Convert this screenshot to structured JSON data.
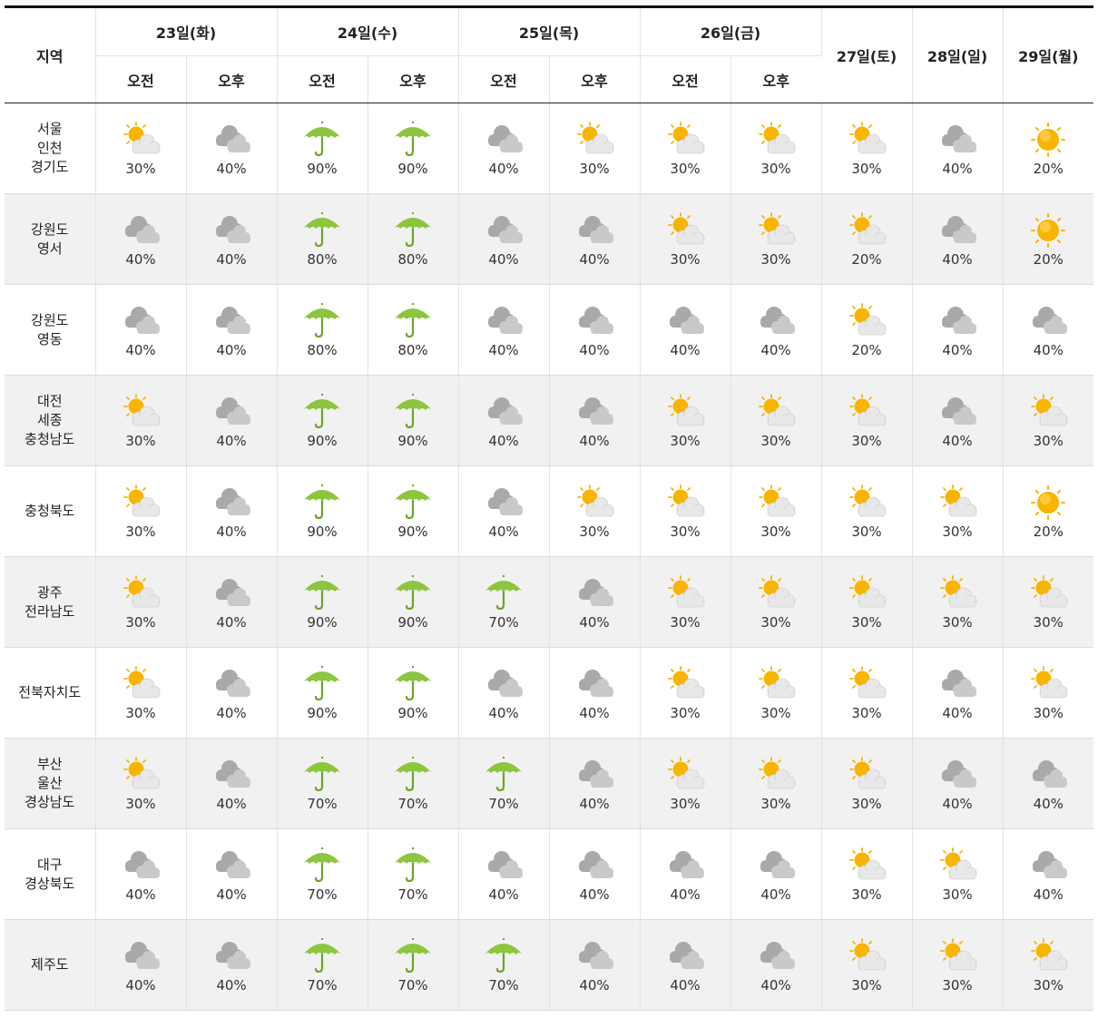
{
  "header": {
    "region_label": "지역",
    "days_split": [
      {
        "label": "23일(화)",
        "am": "오전",
        "pm": "오후"
      },
      {
        "label": "24일(수)",
        "am": "오전",
        "pm": "오후"
      },
      {
        "label": "25일(목)",
        "am": "오전",
        "pm": "오후"
      },
      {
        "label": "26일(금)",
        "am": "오전",
        "pm": "오후"
      }
    ],
    "days_single": [
      "27일(토)",
      "28일(일)",
      "29일(월)"
    ]
  },
  "rows": [
    {
      "region": [
        "서울",
        "인천",
        "경기도"
      ],
      "cells": [
        {
          "icon": "partly-cloudy",
          "pct": "30%"
        },
        {
          "icon": "cloudy",
          "pct": "40%"
        },
        {
          "icon": "rain-umbrella",
          "pct": "90%"
        },
        {
          "icon": "rain-umbrella",
          "pct": "90%"
        },
        {
          "icon": "cloudy",
          "pct": "40%"
        },
        {
          "icon": "partly-cloudy",
          "pct": "30%"
        },
        {
          "icon": "partly-cloudy",
          "pct": "30%"
        },
        {
          "icon": "partly-cloudy",
          "pct": "30%"
        },
        {
          "icon": "partly-cloudy",
          "pct": "30%"
        },
        {
          "icon": "cloudy",
          "pct": "40%"
        },
        {
          "icon": "sunny",
          "pct": "20%"
        }
      ]
    },
    {
      "region": [
        "강원도",
        "영서"
      ],
      "cells": [
        {
          "icon": "cloudy",
          "pct": "40%"
        },
        {
          "icon": "cloudy",
          "pct": "40%"
        },
        {
          "icon": "rain-umbrella",
          "pct": "80%"
        },
        {
          "icon": "rain-umbrella",
          "pct": "80%"
        },
        {
          "icon": "cloudy",
          "pct": "40%"
        },
        {
          "icon": "cloudy",
          "pct": "40%"
        },
        {
          "icon": "partly-cloudy",
          "pct": "30%"
        },
        {
          "icon": "partly-cloudy",
          "pct": "30%"
        },
        {
          "icon": "partly-cloudy",
          "pct": "20%"
        },
        {
          "icon": "cloudy",
          "pct": "40%"
        },
        {
          "icon": "sunny",
          "pct": "20%"
        }
      ]
    },
    {
      "region": [
        "강원도",
        "영동"
      ],
      "cells": [
        {
          "icon": "cloudy",
          "pct": "40%"
        },
        {
          "icon": "cloudy",
          "pct": "40%"
        },
        {
          "icon": "rain-umbrella",
          "pct": "80%"
        },
        {
          "icon": "rain-umbrella",
          "pct": "80%"
        },
        {
          "icon": "cloudy",
          "pct": "40%"
        },
        {
          "icon": "cloudy",
          "pct": "40%"
        },
        {
          "icon": "cloudy",
          "pct": "40%"
        },
        {
          "icon": "cloudy",
          "pct": "40%"
        },
        {
          "icon": "partly-cloudy",
          "pct": "20%"
        },
        {
          "icon": "cloudy",
          "pct": "40%"
        },
        {
          "icon": "cloudy",
          "pct": "40%"
        }
      ]
    },
    {
      "region": [
        "대전",
        "세종",
        "충청남도"
      ],
      "cells": [
        {
          "icon": "partly-cloudy",
          "pct": "30%"
        },
        {
          "icon": "cloudy",
          "pct": "40%"
        },
        {
          "icon": "rain-umbrella",
          "pct": "90%"
        },
        {
          "icon": "rain-umbrella",
          "pct": "90%"
        },
        {
          "icon": "cloudy",
          "pct": "40%"
        },
        {
          "icon": "cloudy",
          "pct": "40%"
        },
        {
          "icon": "partly-cloudy",
          "pct": "30%"
        },
        {
          "icon": "partly-cloudy",
          "pct": "30%"
        },
        {
          "icon": "partly-cloudy",
          "pct": "30%"
        },
        {
          "icon": "cloudy",
          "pct": "40%"
        },
        {
          "icon": "partly-cloudy",
          "pct": "30%"
        }
      ]
    },
    {
      "region": [
        "충청북도"
      ],
      "cells": [
        {
          "icon": "partly-cloudy",
          "pct": "30%"
        },
        {
          "icon": "cloudy",
          "pct": "40%"
        },
        {
          "icon": "rain-umbrella",
          "pct": "90%"
        },
        {
          "icon": "rain-umbrella",
          "pct": "90%"
        },
        {
          "icon": "cloudy",
          "pct": "40%"
        },
        {
          "icon": "partly-cloudy",
          "pct": "30%"
        },
        {
          "icon": "partly-cloudy",
          "pct": "30%"
        },
        {
          "icon": "partly-cloudy",
          "pct": "30%"
        },
        {
          "icon": "partly-cloudy",
          "pct": "30%"
        },
        {
          "icon": "partly-cloudy",
          "pct": "30%"
        },
        {
          "icon": "sunny",
          "pct": "20%"
        }
      ]
    },
    {
      "region": [
        "광주",
        "전라남도"
      ],
      "cells": [
        {
          "icon": "partly-cloudy",
          "pct": "30%"
        },
        {
          "icon": "cloudy",
          "pct": "40%"
        },
        {
          "icon": "rain-umbrella",
          "pct": "90%"
        },
        {
          "icon": "rain-umbrella",
          "pct": "90%"
        },
        {
          "icon": "rain-umbrella",
          "pct": "70%"
        },
        {
          "icon": "cloudy",
          "pct": "40%"
        },
        {
          "icon": "partly-cloudy",
          "pct": "30%"
        },
        {
          "icon": "partly-cloudy",
          "pct": "30%"
        },
        {
          "icon": "partly-cloudy",
          "pct": "30%"
        },
        {
          "icon": "partly-cloudy",
          "pct": "30%"
        },
        {
          "icon": "partly-cloudy",
          "pct": "30%"
        }
      ]
    },
    {
      "region": [
        "전북자치도"
      ],
      "cells": [
        {
          "icon": "partly-cloudy",
          "pct": "30%"
        },
        {
          "icon": "cloudy",
          "pct": "40%"
        },
        {
          "icon": "rain-umbrella",
          "pct": "90%"
        },
        {
          "icon": "rain-umbrella",
          "pct": "90%"
        },
        {
          "icon": "cloudy",
          "pct": "40%"
        },
        {
          "icon": "cloudy",
          "pct": "40%"
        },
        {
          "icon": "partly-cloudy",
          "pct": "30%"
        },
        {
          "icon": "partly-cloudy",
          "pct": "30%"
        },
        {
          "icon": "partly-cloudy",
          "pct": "30%"
        },
        {
          "icon": "cloudy",
          "pct": "40%"
        },
        {
          "icon": "partly-cloudy",
          "pct": "30%"
        }
      ]
    },
    {
      "region": [
        "부산",
        "울산",
        "경상남도"
      ],
      "cells": [
        {
          "icon": "partly-cloudy",
          "pct": "30%"
        },
        {
          "icon": "cloudy",
          "pct": "40%"
        },
        {
          "icon": "rain-umbrella",
          "pct": "70%"
        },
        {
          "icon": "rain-umbrella",
          "pct": "70%"
        },
        {
          "icon": "rain-umbrella",
          "pct": "70%"
        },
        {
          "icon": "cloudy",
          "pct": "40%"
        },
        {
          "icon": "partly-cloudy",
          "pct": "30%"
        },
        {
          "icon": "partly-cloudy",
          "pct": "30%"
        },
        {
          "icon": "partly-cloudy",
          "pct": "30%"
        },
        {
          "icon": "cloudy",
          "pct": "40%"
        },
        {
          "icon": "cloudy",
          "pct": "40%"
        }
      ]
    },
    {
      "region": [
        "대구",
        "경상북도"
      ],
      "cells": [
        {
          "icon": "cloudy",
          "pct": "40%"
        },
        {
          "icon": "cloudy",
          "pct": "40%"
        },
        {
          "icon": "rain-umbrella",
          "pct": "70%"
        },
        {
          "icon": "rain-umbrella",
          "pct": "70%"
        },
        {
          "icon": "cloudy",
          "pct": "40%"
        },
        {
          "icon": "cloudy",
          "pct": "40%"
        },
        {
          "icon": "cloudy",
          "pct": "40%"
        },
        {
          "icon": "cloudy",
          "pct": "40%"
        },
        {
          "icon": "partly-cloudy",
          "pct": "30%"
        },
        {
          "icon": "partly-cloudy",
          "pct": "30%"
        },
        {
          "icon": "cloudy",
          "pct": "40%"
        }
      ]
    },
    {
      "region": [
        "제주도"
      ],
      "cells": [
        {
          "icon": "cloudy",
          "pct": "40%"
        },
        {
          "icon": "cloudy",
          "pct": "40%"
        },
        {
          "icon": "rain-umbrella",
          "pct": "70%"
        },
        {
          "icon": "rain-umbrella",
          "pct": "70%"
        },
        {
          "icon": "rain-umbrella",
          "pct": "70%"
        },
        {
          "icon": "cloudy",
          "pct": "40%"
        },
        {
          "icon": "cloudy",
          "pct": "40%"
        },
        {
          "icon": "cloudy",
          "pct": "40%"
        },
        {
          "icon": "partly-cloudy",
          "pct": "30%"
        },
        {
          "icon": "partly-cloudy",
          "pct": "30%"
        },
        {
          "icon": "partly-cloudy",
          "pct": "30%"
        }
      ]
    }
  ],
  "colors": {
    "sun": "#f7b500",
    "cloud_dark": "#a9a9a9",
    "cloud_light": "#e8e8e8",
    "umbrella": "#8cc63f",
    "row_alt_bg": "#f1f1f1",
    "header_rule": "#111111"
  }
}
